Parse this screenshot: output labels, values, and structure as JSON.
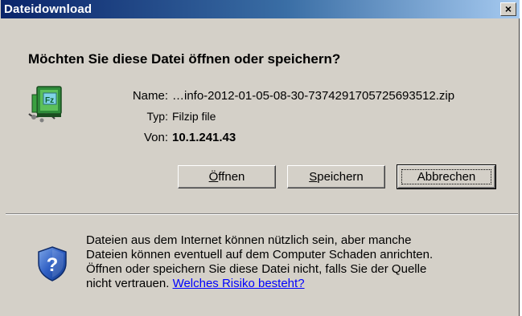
{
  "window": {
    "title": "Dateidownload",
    "close_glyph": "×",
    "colors": {
      "titlebar_start": "#0a246a",
      "titlebar_end": "#a6caf0",
      "face": "#d4d0c8",
      "link": "#0000ff"
    }
  },
  "question": "Möchten Sie diese Datei öffnen oder speichern?",
  "file": {
    "icon": "filzip-archive-icon",
    "name_label": "Name:",
    "name_value": "…info-2012-01-05-08-30-7374291705725693512.zip",
    "type_label": "Typ:",
    "type_value": "Filzip file",
    "from_label": "Von:",
    "from_value": "10.1.241.43"
  },
  "buttons": {
    "open": {
      "accel": "Ö",
      "rest": "ffnen"
    },
    "save": {
      "accel": "S",
      "rest": "peichern"
    },
    "cancel": {
      "label": "Abbrechen"
    }
  },
  "warning": {
    "icon": "shield-question-icon",
    "line1": "Dateien aus dem Internet können nützlich sein, aber manche",
    "line2": "Dateien können eventuell auf dem Computer Schaden anrichten.",
    "line3": "Öffnen oder speichern Sie diese Datei nicht, falls Sie der Quelle",
    "line4": "nicht vertrauen.",
    "link": "Welches Risiko besteht?"
  }
}
